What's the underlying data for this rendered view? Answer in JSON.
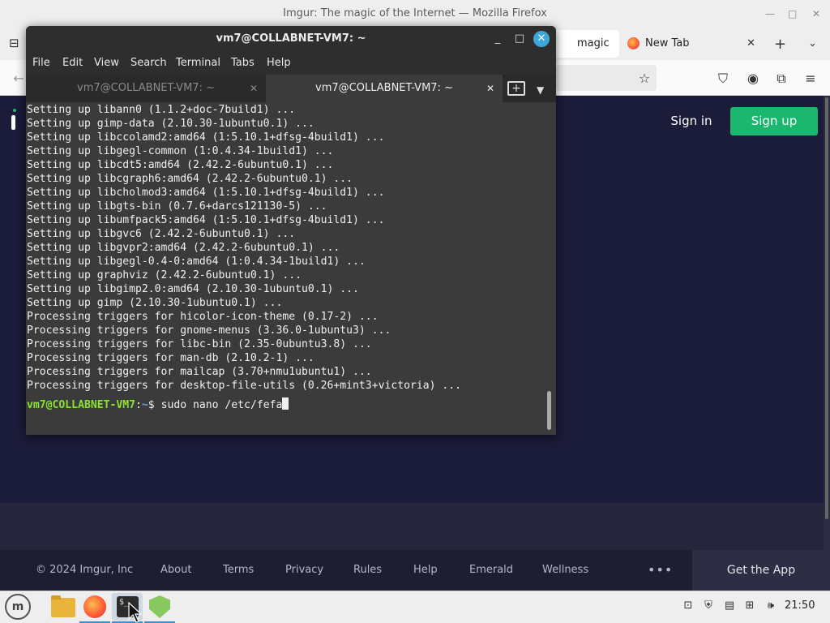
{
  "firefox": {
    "window_title": "Imgur: The magic of the Internet — Mozilla Firefox",
    "tabs": [
      {
        "label": "magic of",
        "active": true
      },
      {
        "label": "New Tab",
        "active": false
      }
    ],
    "content": {
      "sign_in": "Sign in",
      "sign_up": "Sign up"
    },
    "footer": {
      "copyright": "© 2024 Imgur, Inc",
      "links": [
        "About",
        "Terms",
        "Privacy",
        "Rules",
        "Help",
        "Emerald",
        "Wellness"
      ],
      "more": "•••",
      "get_app": "Get the App"
    },
    "colors": {
      "signup_green": "#1bb76e",
      "page_bg": "#1b1b3a"
    }
  },
  "terminal": {
    "title": "vm7@COLLABNET-VM7: ~",
    "menu": [
      "File",
      "Edit",
      "View",
      "Search",
      "Terminal",
      "Tabs",
      "Help"
    ],
    "tabs": [
      "vm7@COLLABNET-VM7: ~",
      "vm7@COLLABNET-VM7: ~"
    ],
    "lines": [
      "Setting up libann0 (1.1.2+doc-7build1) ...",
      "Setting up gimp-data (2.10.30-1ubuntu0.1) ...",
      "Setting up libccolamd2:amd64 (1:5.10.1+dfsg-4build1) ...",
      "Setting up libgegl-common (1:0.4.34-1build1) ...",
      "Setting up libcdt5:amd64 (2.42.2-6ubuntu0.1) ...",
      "Setting up libcgraph6:amd64 (2.42.2-6ubuntu0.1) ...",
      "Setting up libcholmod3:amd64 (1:5.10.1+dfsg-4build1) ...",
      "Setting up libgts-bin (0.7.6+darcs121130-5) ...",
      "Setting up libumfpack5:amd64 (1:5.10.1+dfsg-4build1) ...",
      "Setting up libgvc6 (2.42.2-6ubuntu0.1) ...",
      "Setting up libgvpr2:amd64 (2.42.2-6ubuntu0.1) ...",
      "Setting up libgegl-0.4-0:amd64 (1:0.4.34-1build1) ...",
      "Setting up graphviz (2.42.2-6ubuntu0.1) ...",
      "Setting up libgimp2.0:amd64 (2.10.30-1ubuntu0.1) ...",
      "Setting up gimp (2.10.30-1ubuntu0.1) ...",
      "Processing triggers for hicolor-icon-theme (0.17-2) ...",
      "Processing triggers for gnome-menus (3.36.0-1ubuntu3) ...",
      "Processing triggers for libc-bin (2.35-0ubuntu3.8) ...",
      "Processing triggers for man-db (2.10.2-1) ...",
      "Processing triggers for mailcap (3.70+nmu1ubuntu1) ...",
      "Processing triggers for desktop-file-utils (0.26+mint3+victoria) ..."
    ],
    "prompt_user": "vm7@COLLABNET-VM7",
    "prompt_sep": ":",
    "prompt_path": "~",
    "prompt_symbol": "$ ",
    "command": "sudo nano /etc/fefa",
    "colors": {
      "prompt_user": "#8ae234",
      "prompt_path": "#729fcf",
      "bg": "#3b3b3b"
    }
  },
  "taskbar": {
    "clock": "21:50",
    "apps": [
      "menu-icon",
      "files-icon",
      "firefox-icon",
      "terminal-icon",
      "update-manager-icon"
    ]
  }
}
